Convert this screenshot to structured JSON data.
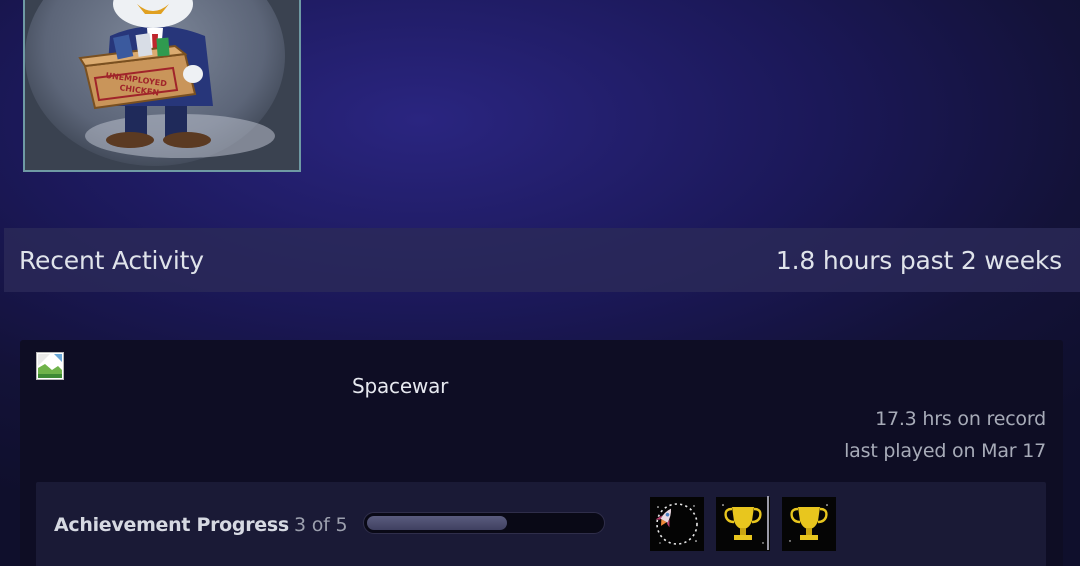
{
  "avatar": {
    "box_line1": "UNEMPLOYED",
    "box_line2": "CHICKEN"
  },
  "activity": {
    "title": "Recent Activity",
    "hours_summary": "1.8 hours past 2 weeks"
  },
  "game": {
    "name": "Spacewar",
    "hours_on_record": "17.3 hrs on record",
    "last_played": "last played on Mar 17",
    "capsule_icon": "broken-image-icon"
  },
  "achievements": {
    "label": "Achievement Progress",
    "count": "3 of 5",
    "unlocked": 3,
    "total": 5,
    "progress_fraction": 0.6,
    "icons": [
      "rocket-achievement-icon",
      "trophy-icon",
      "trophy-icon"
    ]
  },
  "colors": {
    "trophy": "#e8c61e",
    "avatar_border": "#6f9aa4"
  }
}
